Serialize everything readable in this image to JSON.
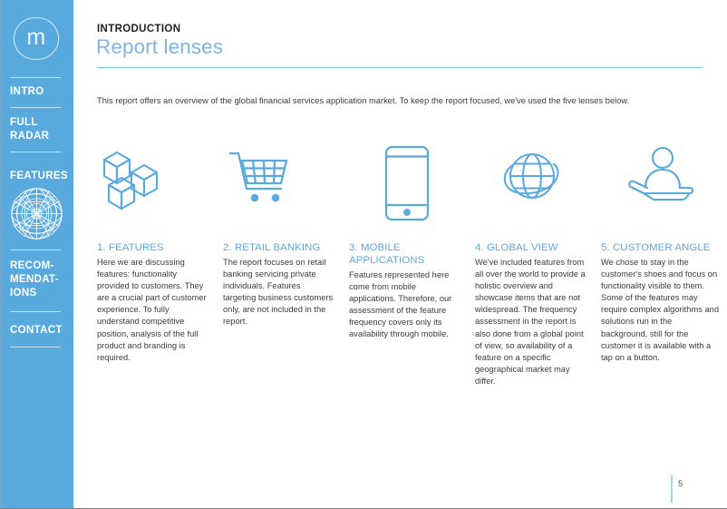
{
  "brand": {
    "logo_letter": "m",
    "accent_color": "#58a9de",
    "rule_color": "#79cbe8",
    "heading_color": "#5ba8e0"
  },
  "sidebar": {
    "items": [
      {
        "label": "INTRO",
        "name": "sidebar-item-intro"
      },
      {
        "label": "FULL\nRADAR",
        "name": "sidebar-item-full-radar"
      },
      {
        "label": "FEATURES",
        "name": "sidebar-item-features"
      },
      {
        "label": "RECOM-\nMENDAT-\nIONS",
        "name": "sidebar-item-recommendations"
      },
      {
        "label": "CONTACT",
        "name": "sidebar-item-contact"
      }
    ],
    "radar_icon": "radar-chart-icon"
  },
  "header": {
    "eyebrow": "INTRODUCTION",
    "title": "Report lenses"
  },
  "intro": {
    "text": "This report offers an overview of the global financial services application market. To keep the report focused, we've used the five lenses below."
  },
  "lenses": [
    {
      "icon": "cubes-icon",
      "heading": "1. FEATURES",
      "body": "Here we are discussing features: functionality provided to customers. They are a crucial part of customer experience. To fully understand competitive position, analysis of the full product and branding is required."
    },
    {
      "icon": "shopping-cart-icon",
      "heading": "2. RETAIL BANKING",
      "body": "The report focuses on retail banking servicing private individuals. Features targeting business customers only, are not included in the report."
    },
    {
      "icon": "mobile-phone-icon",
      "heading": "3. MOBILE APPLICATIONS",
      "body": "Features represented here come from mobile applications. Therefore, our assessment of the feature frequency covers only its availability through mobile."
    },
    {
      "icon": "globe-icon",
      "heading": "4. GLOBAL VIEW",
      "body": "We've included features from all over the world to provide a holistic overview and showcase items that are not widespread. The frequency assessment in the report is also done from a global point of view, so availability of a feature on a specific geographical market may differ."
    },
    {
      "icon": "customer-in-hand-icon",
      "heading": "5. CUSTOMER ANGLE",
      "body": "We chose to stay in the customer's shoes and focus on functionality visible to them. Some of the features may require complex algorithms and solutions run in the background, still for the customer it is available with a tap on a button."
    }
  ],
  "footer": {
    "page_number": "5"
  }
}
